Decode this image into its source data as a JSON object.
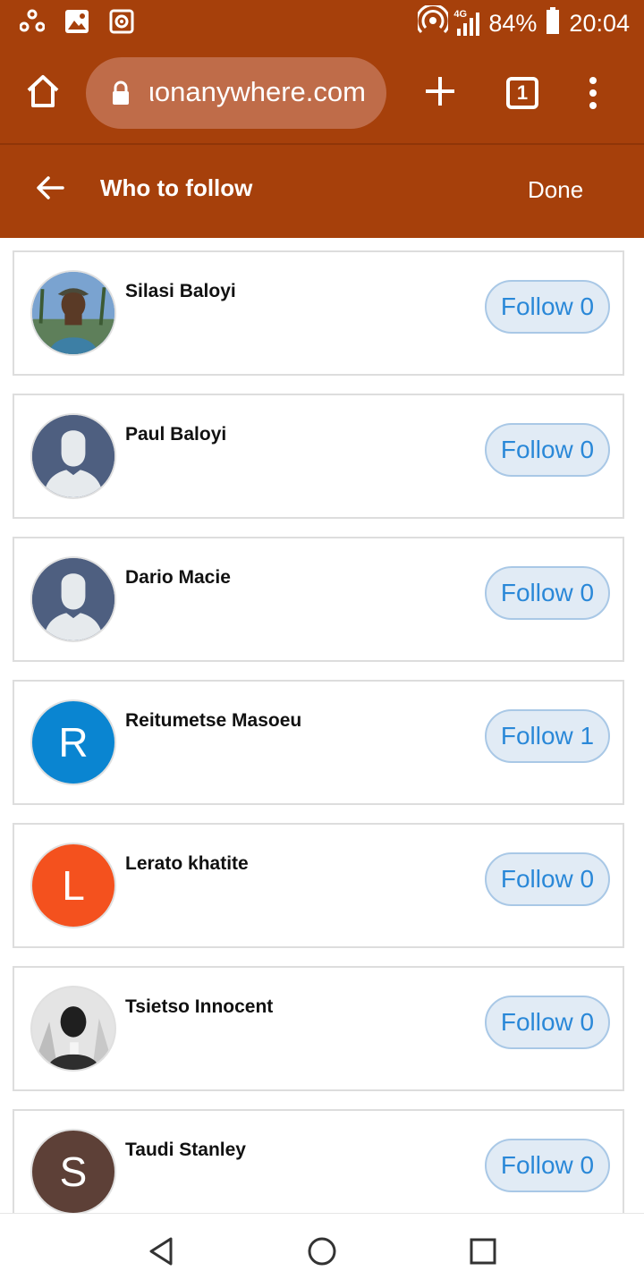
{
  "status_bar": {
    "signal_label": "4G",
    "battery": "84%",
    "time": "20:04"
  },
  "browser": {
    "url": "ιonanywhere.com",
    "tab_count": "1"
  },
  "header": {
    "title": "Who to follow",
    "done_label": "Done"
  },
  "colors": {
    "brand": "#a6400b",
    "follow_text": "#2a88d8",
    "follow_bg": "#e1ebf5"
  },
  "users": [
    {
      "name": "Silasi Baloyi",
      "follow_label": "Follow 0",
      "avatar_type": "photo"
    },
    {
      "name": "Paul Baloyi",
      "follow_label": "Follow 0",
      "avatar_type": "placeholder"
    },
    {
      "name": "Dario Macie",
      "follow_label": "Follow 0",
      "avatar_type": "placeholder"
    },
    {
      "name": "Reitumetse Masoeu",
      "follow_label": "Follow 1",
      "avatar_type": "letter",
      "letter": "R",
      "color": "#0a85d1"
    },
    {
      "name": "Lerato khatite",
      "follow_label": "Follow 0",
      "avatar_type": "letter",
      "letter": "L",
      "color": "#f4511e"
    },
    {
      "name": "Tsietso Innocent",
      "follow_label": "Follow 0",
      "avatar_type": "photo-bw"
    },
    {
      "name": "Taudi Stanley",
      "follow_label": "Follow 0",
      "avatar_type": "letter",
      "letter": "S",
      "color": "#5d4037"
    }
  ]
}
